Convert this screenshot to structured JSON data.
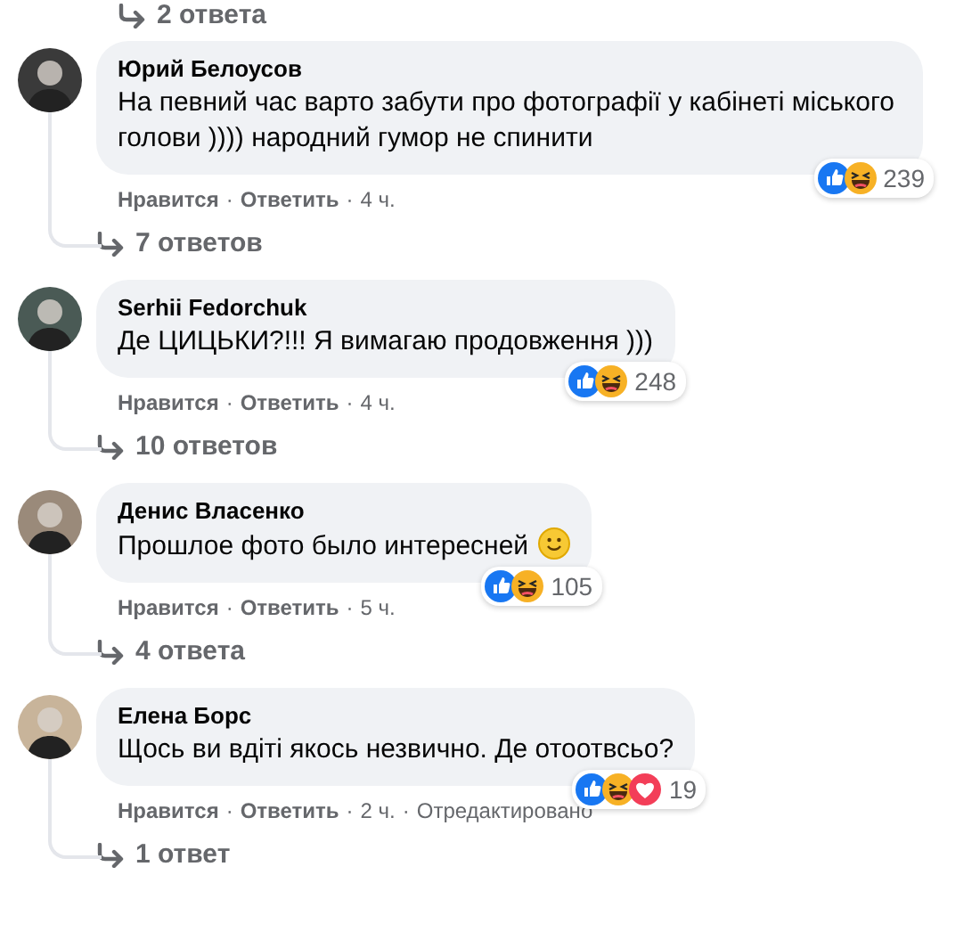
{
  "top_replies_link": "2 ответа",
  "comments": [
    {
      "author": "Юрий Белоусов",
      "text": "На певний час варто забути про фотографії у кабінеті міського голови )))) народний гумор не спинити",
      "emoji": false,
      "reactions": [
        {
          "kind": "like"
        },
        {
          "kind": "haha"
        }
      ],
      "reaction_count": "239",
      "meta": [
        {
          "kind": "link",
          "text": "Нравится"
        },
        {
          "kind": "sep",
          "text": "·"
        },
        {
          "kind": "link",
          "text": "Ответить"
        },
        {
          "kind": "sep",
          "text": "·"
        },
        {
          "kind": "time",
          "text": "4 ч."
        }
      ],
      "replies": "7 ответов"
    },
    {
      "author": "Serhii Fedorchuk",
      "text": "Де ЦИЦЬКИ?!!! Я вимагаю продовження )))",
      "emoji": false,
      "reactions": [
        {
          "kind": "like"
        },
        {
          "kind": "haha"
        }
      ],
      "reaction_count": "248",
      "meta": [
        {
          "kind": "link",
          "text": "Нравится"
        },
        {
          "kind": "sep",
          "text": "·"
        },
        {
          "kind": "link",
          "text": "Ответить"
        },
        {
          "kind": "sep",
          "text": "·"
        },
        {
          "kind": "time",
          "text": "4 ч."
        }
      ],
      "replies": "10 ответов"
    },
    {
      "author": "Денис Власенко",
      "text": "Прошлое фото было интересней",
      "emoji": true,
      "reactions": [
        {
          "kind": "like"
        },
        {
          "kind": "haha"
        }
      ],
      "reaction_count": "105",
      "meta": [
        {
          "kind": "link",
          "text": "Нравится"
        },
        {
          "kind": "sep",
          "text": "·"
        },
        {
          "kind": "link",
          "text": "Ответить"
        },
        {
          "kind": "sep",
          "text": "·"
        },
        {
          "kind": "time",
          "text": "5 ч."
        }
      ],
      "replies": "4 ответа"
    },
    {
      "author": "Елена Борс",
      "text": "Щось ви вдіті якось незвично. Де отоотвсьо?",
      "emoji": false,
      "reactions": [
        {
          "kind": "like"
        },
        {
          "kind": "haha"
        },
        {
          "kind": "love"
        }
      ],
      "reaction_count": "19",
      "meta": [
        {
          "kind": "link",
          "text": "Нравится"
        },
        {
          "kind": "sep",
          "text": "·"
        },
        {
          "kind": "link",
          "text": "Ответить"
        },
        {
          "kind": "sep",
          "text": "·"
        },
        {
          "kind": "time",
          "text": "2 ч."
        },
        {
          "kind": "sep",
          "text": "·"
        },
        {
          "kind": "note",
          "text": "Отредактировано"
        }
      ],
      "replies": "1 ответ"
    }
  ]
}
